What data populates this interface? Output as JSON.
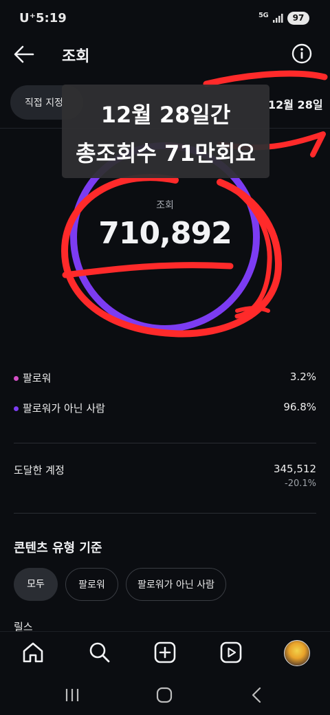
{
  "status_bar": {
    "carrier": "U⁺",
    "time": "5:19",
    "network": "5G",
    "battery": "97"
  },
  "header": {
    "title": "조회",
    "back_icon": "arrow-left-icon",
    "info_icon": "info-icon"
  },
  "date_filter": {
    "chip_label": "직접 지정",
    "range_end": "12월 28일"
  },
  "overlay_caption": {
    "line1": "12월 28일간",
    "line2": "총조회수 71만회요"
  },
  "summary": {
    "label": "조회",
    "total": "710,892",
    "colors": {
      "follower": "#d44fc6",
      "non_follower": "#7c3cf2",
      "annotation": "#ff2a2a"
    }
  },
  "breakdown": [
    {
      "label": "팔로워",
      "value": "3.2%",
      "fraction": 0.032
    },
    {
      "label": "팔로워가 아닌 사람",
      "value": "96.8%",
      "fraction": 0.968
    }
  ],
  "reach": {
    "label": "도달한 계정",
    "value": "345,512",
    "change": "-20.1%"
  },
  "content_type": {
    "title": "콘텐츠 유형 기준",
    "chips": [
      "모두",
      "팔로워",
      "팔로워가 아닌 사람"
    ],
    "selected": "모두",
    "first_item": "릴스"
  },
  "bottom_nav": [
    "home-icon",
    "search-icon",
    "create-icon",
    "reels-icon",
    "profile-avatar"
  ],
  "system_nav": [
    "recents-icon",
    "home-circle-icon",
    "back-chevron-icon"
  ]
}
